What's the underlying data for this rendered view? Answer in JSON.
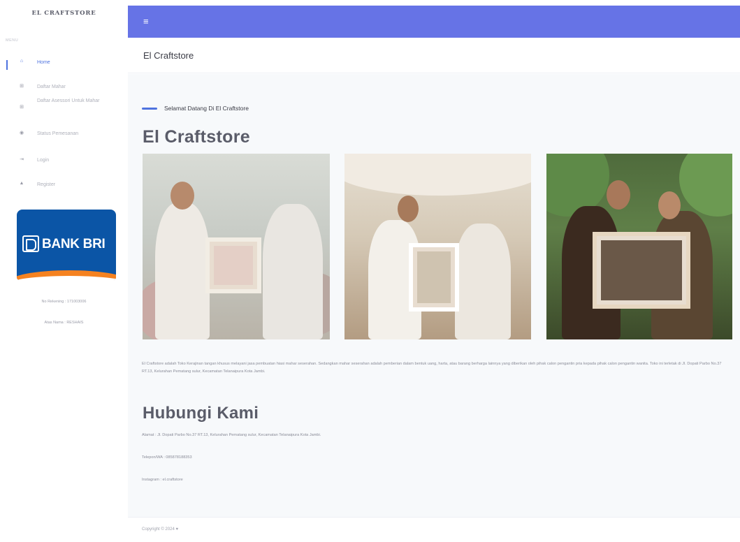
{
  "sidebar": {
    "brand": "EL CRAFTSTORE",
    "heading": "MENU",
    "items": [
      {
        "label": "Home",
        "icon": "home-icon"
      },
      {
        "label": "Daftar Mahar",
        "icon": "table-icon"
      },
      {
        "label": "Daftar Asessori Untuk Mahar",
        "icon": "table-icon"
      },
      {
        "label": "Status Pemesanan",
        "icon": "eye-icon"
      },
      {
        "label": "Login",
        "icon": "sign-in-icon"
      },
      {
        "label": "Register",
        "icon": "user-icon"
      }
    ],
    "bank": {
      "name": "BANK BRI"
    },
    "account_number": "No Rekening : 171003006",
    "account_name": "Atas Nama : RESHAIS"
  },
  "topbar": {
    "menu_icon": "hamburger-icon"
  },
  "page_header": {
    "title": "El Craftstore"
  },
  "main": {
    "welcome": "Selamat Datang Di El Craftstore",
    "title": "El Craftstore",
    "description": "El Craftstore adalah Toko Kerajinan tangan khusus melayani jasa pembuatan hiasi mahar seserahan. Sedangkan mahar seserahan adalah pemberian dalam bentuk uang, harta, atau barang berharga lainnya yang diberikan oleh pihak calon pengantin pria kepada pihak calon pengantin wanita. Toko ini terletak di Jl. Dopati Parbo No.37 RT.13, Kelurahan Pematang sulur, Kecamatan Telanaipura Kota Jambi.",
    "contact_title": "Hubungi Kami",
    "address": "Alamat : Jl. Dopati Parbo No.37 RT.13, Kelurahan Pematang sulur, Kecamatan Telanaipura Kota Jambi.",
    "phone": "Telepon/WA : 085878188353",
    "instagram": "Instagram : el.craftstore"
  },
  "footer": {
    "copyright": "Copyright © 2024 ♥"
  },
  "colors": {
    "accent": "#4e73df",
    "topbar": "#6673e6",
    "bri_blue": "#0b55a6",
    "bri_orange": "#f58220"
  }
}
